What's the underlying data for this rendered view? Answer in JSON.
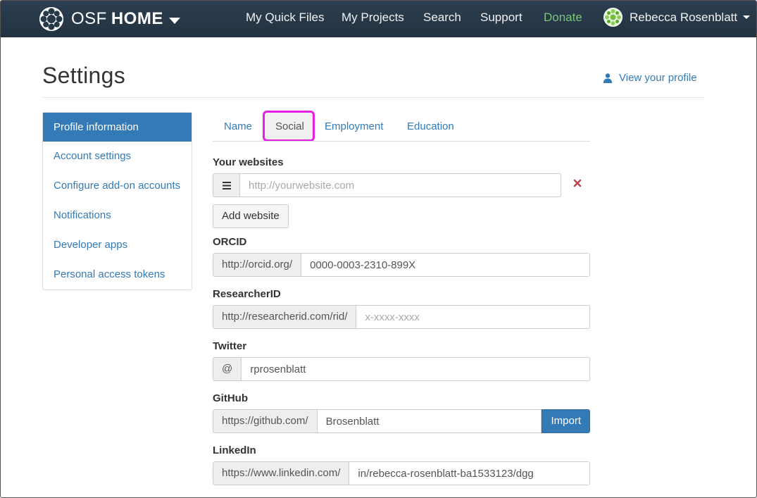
{
  "navbar": {
    "brand_osf": "OSF",
    "brand_home": "HOME",
    "links": {
      "quick_files": "My Quick Files",
      "projects": "My Projects",
      "search": "Search",
      "support": "Support",
      "donate": "Donate"
    },
    "user_name": "Rebecca Rosenblatt",
    "donate_color": "#7ac57a"
  },
  "header": {
    "title": "Settings",
    "view_profile": "View your profile"
  },
  "sidebar": {
    "items": [
      {
        "label": "Profile information",
        "active": true
      },
      {
        "label": "Account settings"
      },
      {
        "label": "Configure add-on accounts"
      },
      {
        "label": "Notifications"
      },
      {
        "label": "Developer apps"
      },
      {
        "label": "Personal access tokens"
      }
    ],
    "accent": "#337ab7"
  },
  "tabs": {
    "name": "Name",
    "social": "Social",
    "employment": "Employment",
    "education": "Education",
    "active": "Social",
    "highlight_color": "#e61ee6"
  },
  "form": {
    "websites": {
      "label": "Your websites",
      "placeholder": "http://yourwebsite.com",
      "value": "",
      "add_button": "Add website"
    },
    "orcid": {
      "label": "ORCID",
      "prefix": "http://orcid.org/",
      "value": "0000-0003-2310-899X",
      "placeholder": ""
    },
    "researcherid": {
      "label": "ResearcherID",
      "prefix": "http://researcherid.com/rid/",
      "value": "",
      "placeholder": "x-xxxx-xxxx"
    },
    "twitter": {
      "label": "Twitter",
      "prefix": "@",
      "value": "rprosenblatt",
      "placeholder": ""
    },
    "github": {
      "label": "GitHub",
      "prefix": "https://github.com/",
      "value": "Brosenblatt",
      "placeholder": "",
      "import_button": "Import"
    },
    "linkedin": {
      "label": "LinkedIn",
      "prefix": "https://www.linkedin.com/",
      "value": "in/rebecca-rosenblatt-ba1533123/dgg",
      "placeholder": ""
    }
  }
}
